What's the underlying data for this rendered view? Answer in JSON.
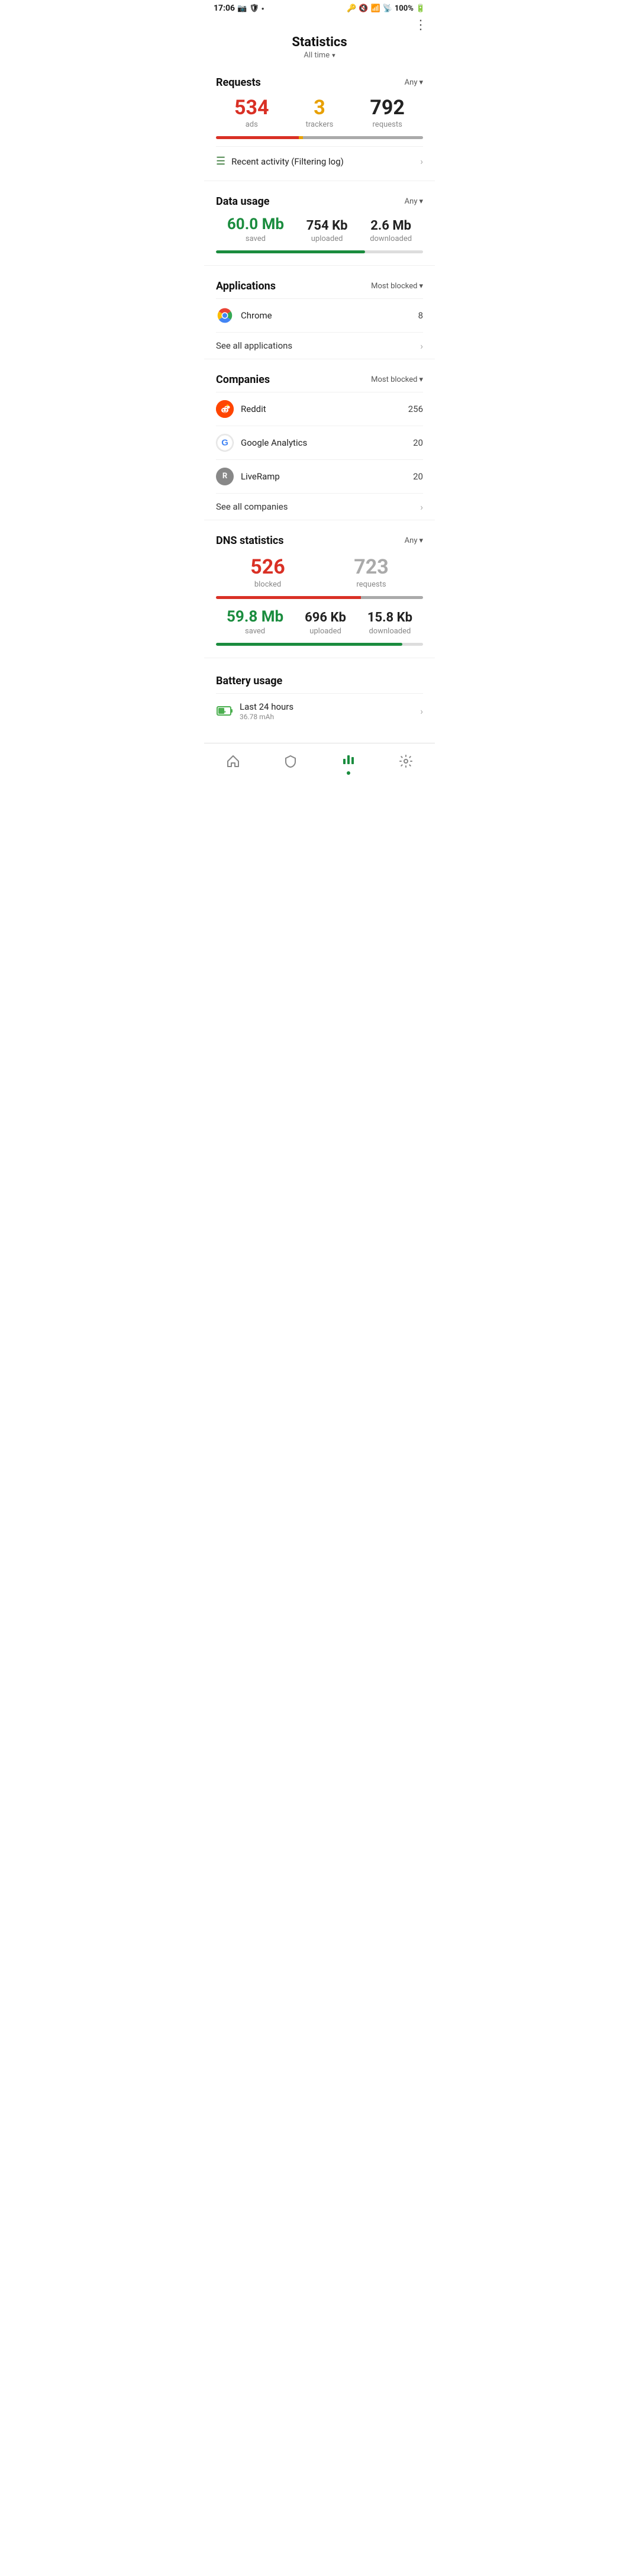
{
  "statusBar": {
    "time": "17:06",
    "batteryPercent": "100%"
  },
  "header": {
    "moreMenuLabel": "⋮",
    "pageTitle": "Statistics",
    "pageSubtitle": "All time"
  },
  "requests": {
    "sectionTitle": "Requests",
    "filterLabel": "Any",
    "adsCount": "534",
    "adsLabel": "ads",
    "trackersCount": "3",
    "trackersLabel": "trackers",
    "requestsCount": "792",
    "requestsLabel": "requests",
    "barAdsPercent": 40,
    "barTrackersPercent": 2,
    "barRestPercent": 58
  },
  "recentActivity": {
    "label": "Recent activity (Filtering log)"
  },
  "dataUsage": {
    "sectionTitle": "Data usage",
    "filterLabel": "Any",
    "savedAmount": "60.0 Mb",
    "savedLabel": "saved",
    "uploadedAmount": "754 Kb",
    "uploadedLabel": "uploaded",
    "downloadedAmount": "2.6 Mb",
    "downloadedLabel": "downloaded",
    "barFillPercent": 72
  },
  "applications": {
    "sectionTitle": "Applications",
    "filterLabel": "Most blocked",
    "items": [
      {
        "name": "Chrome",
        "count": "8",
        "iconType": "chrome"
      }
    ],
    "seeAllLabel": "See all applications"
  },
  "companies": {
    "sectionTitle": "Companies",
    "filterLabel": "Most blocked",
    "items": [
      {
        "name": "Reddit",
        "count": "256",
        "iconType": "reddit"
      },
      {
        "name": "Google Analytics",
        "count": "20",
        "iconType": "google"
      },
      {
        "name": "LiveRamp",
        "count": "20",
        "iconType": "liveramp"
      }
    ],
    "seeAllLabel": "See all companies"
  },
  "dnsStats": {
    "sectionTitle": "DNS statistics",
    "filterLabel": "Any",
    "blockedCount": "526",
    "blockedLabel": "blocked",
    "requestsCount": "723",
    "requestsLabel": "requests",
    "barFillPercent": 70,
    "savedAmount": "59.8 Mb",
    "savedLabel": "saved",
    "uploadedAmount": "696 Kb",
    "uploadedLabel": "uploaded",
    "downloadedAmount": "15.8 Kb",
    "downloadedLabel": "downloaded",
    "barFillPercent2": 90
  },
  "battery": {
    "sectionTitle": "Battery usage",
    "rowLabel": "Last 24 hours",
    "rowSub": "36.78 mAh"
  },
  "bottomNav": {
    "homeLabel": "home",
    "shieldLabel": "shield",
    "statsLabel": "stats",
    "settingsLabel": "settings"
  }
}
